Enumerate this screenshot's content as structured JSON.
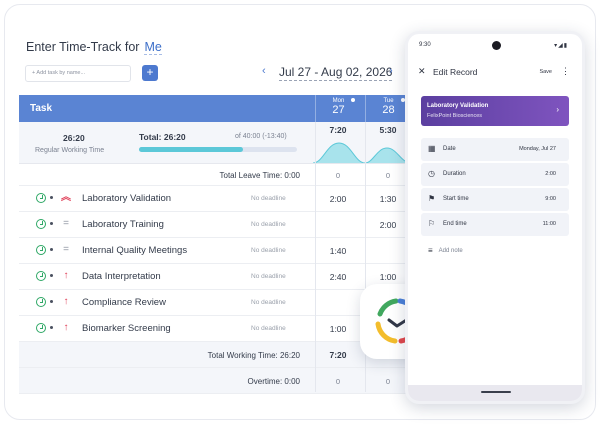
{
  "header": {
    "title": "Enter Time-Track for",
    "user": "Me"
  },
  "toolbar": {
    "add_task_placeholder": "+ Add task by name...",
    "add_label": "+",
    "prev": "‹",
    "next": "›",
    "date_range": "Jul 27 - Aug 02, 2026"
  },
  "table": {
    "task_header": "Task",
    "days": [
      {
        "name": "Mon",
        "num": "27"
      },
      {
        "name": "Tue",
        "num": "28"
      }
    ],
    "summary": {
      "hours": "26:20",
      "label": "Regular Working Time",
      "total": "Total: 26:20",
      "of": "of 40:00 (-13:40)",
      "progress": 0.66,
      "day_totals": [
        "7:20",
        "5:30"
      ]
    },
    "leave": {
      "label": "Total Leave Time: 0:00",
      "values": [
        "0",
        "0"
      ]
    },
    "rows": [
      {
        "priority": "high2",
        "priority_icon": "double-chevron-up-icon",
        "name": "Laboratory Validation",
        "deadline": "No deadline",
        "values": [
          "2:00",
          "1:30"
        ]
      },
      {
        "priority": "med",
        "priority_icon": "equals-icon",
        "name": "Laboratory Training",
        "deadline": "No deadline",
        "values": [
          "",
          "2:00"
        ]
      },
      {
        "priority": "med",
        "priority_icon": "equals-icon",
        "name": "Internal Quality Meetings",
        "deadline": "No deadline",
        "values": [
          "1:40",
          ""
        ]
      },
      {
        "priority": "high",
        "priority_icon": "arrow-up-icon",
        "name": "Data Interpretation",
        "deadline": "No deadline",
        "values": [
          "2:40",
          "1:00"
        ]
      },
      {
        "priority": "high",
        "priority_icon": "arrow-up-icon",
        "name": "Compliance Review",
        "deadline": "No deadline",
        "values": [
          "",
          ""
        ]
      },
      {
        "priority": "high",
        "priority_icon": "arrow-up-icon",
        "name": "Biomarker Screening",
        "deadline": "No deadline",
        "values": [
          "1:00",
          ""
        ]
      }
    ],
    "total_working": {
      "label": "Total Working Time: 26:20",
      "values": [
        "7:20",
        ""
      ]
    },
    "overtime": {
      "label": "Overtime: 0:00",
      "values": [
        "0",
        "0"
      ]
    }
  },
  "phone": {
    "time": "9:30",
    "status_icons": "▾◢▮",
    "title": "Edit Record",
    "close": "✕",
    "save": "Save",
    "more": "⋮",
    "task": {
      "name": "Laboratory Validation",
      "project": "FelixPoint Biosciences",
      "chevron": "›"
    },
    "fields": [
      {
        "icon": "calendar-icon",
        "glyph": "▦",
        "label": "Date",
        "value": "Monday, Jul 27"
      },
      {
        "icon": "clock-icon",
        "glyph": "◷",
        "label": "Duration",
        "value": "2:00"
      },
      {
        "icon": "start-flag-icon",
        "glyph": "⚑",
        "label": "Start time",
        "value": "9:00"
      },
      {
        "icon": "end-flag-icon",
        "glyph": "⚐",
        "label": "End time",
        "value": "11:00"
      }
    ],
    "note": {
      "glyph": "≡",
      "label": "Add note"
    }
  },
  "colors": {
    "accent": "#5a84d3",
    "header_blue": "#4d79cf",
    "purple": "#6a48b0",
    "green": "#2fa866",
    "red": "#e0435b",
    "teal": "#5cc8d8"
  }
}
